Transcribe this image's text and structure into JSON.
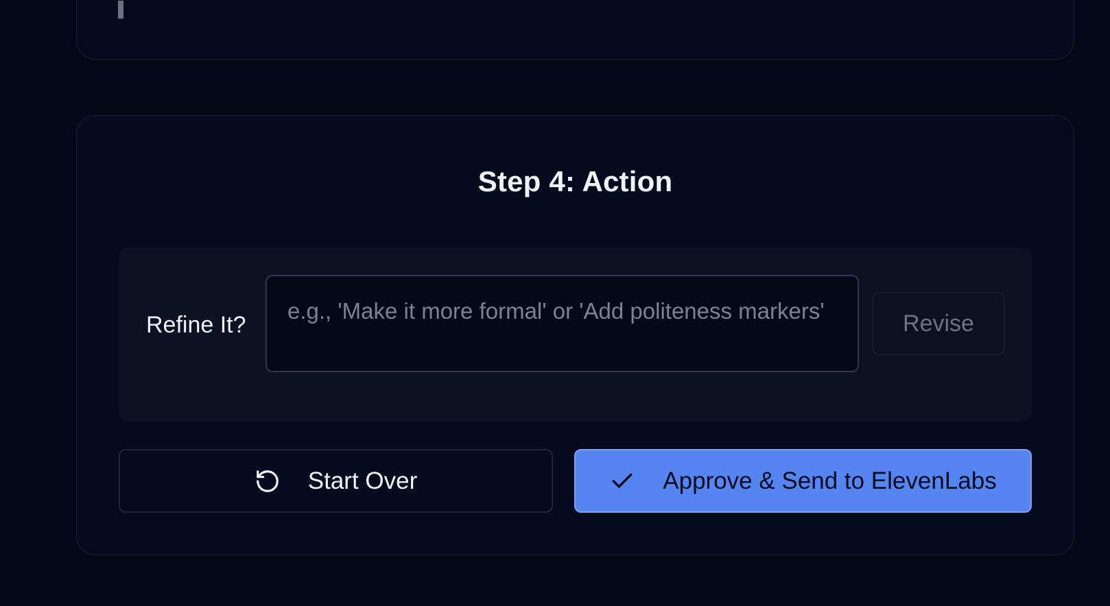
{
  "step": {
    "title": "Step 4: Action"
  },
  "refine": {
    "label": "Refine It?",
    "placeholder": "e.g., 'Make it more formal' or 'Add politeness markers'",
    "value": "",
    "revise_label": "Revise"
  },
  "actions": {
    "start_over_label": "Start Over",
    "start_over_icon": "refresh-icon",
    "approve_label": "Approve & Send to ElevenLabs",
    "approve_icon": "check-icon"
  },
  "colors": {
    "background": "#030816",
    "card": "#050b1f",
    "accent": "#5585f0"
  }
}
